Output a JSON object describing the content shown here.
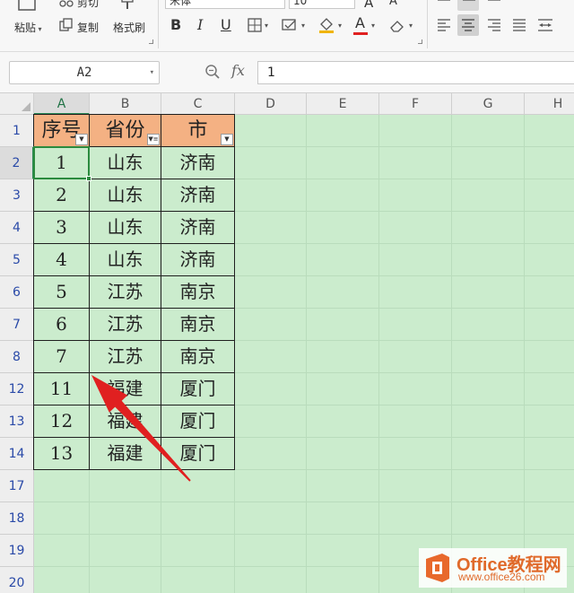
{
  "ribbon": {
    "paste_label": "粘贴",
    "cut_label": "剪切",
    "copy_label": "复制",
    "format_painter_label": "格式刷",
    "font_name": "宋体",
    "font_size": "10",
    "bold_label": "B",
    "italic_label": "I",
    "underline_label": "U",
    "font_color_label": "A",
    "font_grow_label": "A",
    "font_shrink_label": "A"
  },
  "formula_bar": {
    "name_box": "A2",
    "fx_label": "fx",
    "formula": "1"
  },
  "sheet": {
    "columns": [
      "A",
      "B",
      "C",
      "D",
      "E",
      "F",
      "G",
      "H"
    ],
    "active_column": "A",
    "rows": [
      "1",
      "2",
      "3",
      "4",
      "5",
      "6",
      "7",
      "8",
      "12",
      "13",
      "14",
      "17",
      "18",
      "19",
      "20"
    ],
    "active_row": "2",
    "headers": [
      "序号",
      "省份",
      "市"
    ],
    "data": [
      [
        "1",
        "山东",
        "济南"
      ],
      [
        "2",
        "山东",
        "济南"
      ],
      [
        "3",
        "山东",
        "济南"
      ],
      [
        "4",
        "山东",
        "济南"
      ],
      [
        "5",
        "江苏",
        "南京"
      ],
      [
        "6",
        "江苏",
        "南京"
      ],
      [
        "7",
        "江苏",
        "南京"
      ],
      [
        "11",
        "福建",
        "厦门"
      ],
      [
        "12",
        "福建",
        "厦门"
      ],
      [
        "13",
        "福建",
        "厦门"
      ]
    ],
    "header_fill_color": "#f4b183",
    "sheet_background_color": "#cbeccd",
    "selected_cell": "A2",
    "filter_applied_column": "B"
  },
  "annotation": {
    "arrow_color": "#e02020",
    "points_to": "row-numbers-jump-8-to-12"
  },
  "watermark": {
    "name": "Office教程网",
    "url": "www.office26.com",
    "logo": "office-logo-icon"
  }
}
